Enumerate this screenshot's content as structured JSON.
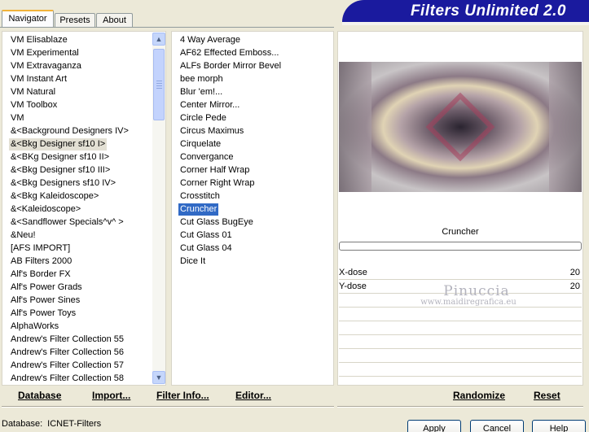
{
  "tabs": [
    "Navigator",
    "Presets",
    "About"
  ],
  "app_title": "Filters Unlimited 2.0",
  "categories": [
    "VM Elisablaze",
    "VM Experimental",
    "VM Extravaganza",
    "VM Instant Art",
    "VM Natural",
    "VM Toolbox",
    "VM",
    "&<Background Designers IV>",
    "&<Bkg Designer sf10 I>",
    "&<BKg Designer sf10 II>",
    "&<Bkg Designer sf10 III>",
    "&<Bkg Designers sf10 IV>",
    "&<Bkg Kaleidoscope>",
    "&<Kaleidoscope>",
    "&<Sandflower Specials^v^ >",
    "&Neu!",
    "[AFS IMPORT]",
    "AB Filters 2000",
    "Alf's Border FX",
    "Alf's Power Grads",
    "Alf's Power Sines",
    "Alf's Power Toys",
    "AlphaWorks",
    "Andrew's Filter Collection 55",
    "Andrew's Filter Collection 56",
    "Andrew's Filter Collection 57",
    "Andrew's Filter Collection 58"
  ],
  "selected_category": "&<Bkg Designer sf10 I>",
  "filters": [
    "4 Way Average",
    "AF62 Effected Emboss...",
    "ALFs Border Mirror Bevel",
    "bee morph",
    "Blur 'em!...",
    "Center Mirror...",
    "Circle Pede",
    "Circus Maximus",
    "Cirquelate",
    "Convergance",
    "Corner Half Wrap",
    "Corner Right Wrap",
    "Crosstitch",
    "Cruncher",
    "Cut Glass  BugEye",
    "Cut Glass 01",
    "Cut Glass 04",
    "Dice It"
  ],
  "selected_filter": "Cruncher",
  "current_filter_name": "Cruncher",
  "params": [
    {
      "label": "X-dose",
      "value": "20"
    },
    {
      "label": "Y-dose",
      "value": "20"
    }
  ],
  "watermark": {
    "line1": "Pinuccia",
    "line2": "www.maidiregrafica.eu"
  },
  "toolbar": {
    "database": "Database",
    "import": "Import...",
    "filter_info": "Filter Info...",
    "editor": "Editor...",
    "randomize": "Randomize",
    "reset": "Reset"
  },
  "status": {
    "database_label": "Database:",
    "database_value": "ICNET-Filters"
  },
  "buttons": {
    "apply": "Apply",
    "cancel": "Cancel",
    "help": "Help"
  },
  "colors": {
    "banner": "#1a1a9e",
    "selection": "#316ac5",
    "tab_highlight": "#f1b33a"
  }
}
